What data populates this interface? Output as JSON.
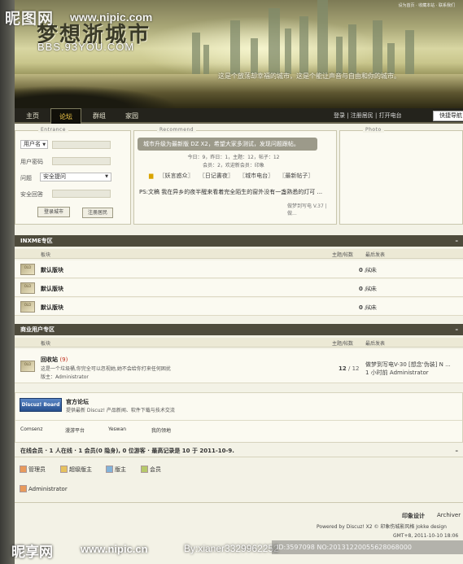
{
  "watermarks": {
    "top_left": "昵图网",
    "top_url": "www.nipic.com",
    "bottom_left": "昵享网",
    "bottom_url": "www.nipic.cn",
    "bottom_by": "By:xianer3329962252",
    "bottom_id": "ID:3597098 NO:20131220055628068000"
  },
  "banner": {
    "logo": "梦想浙城市",
    "logo_url": "BBS.93YOU.COM",
    "slogan": "这是个放荡却幸福的城市，这是个能让声音与自由和你的城市。",
    "tiny_links": "设为首页 · 收藏本站 · 联系我们"
  },
  "nav": {
    "items": [
      "主页",
      "论坛",
      "群组",
      "家园"
    ],
    "right_links": "登录 | 注册居民 | 打开电台",
    "quick_nav": "快捷导航"
  },
  "login": {
    "title": "Entrance",
    "username_select": "用户名",
    "password_label": "用户密码",
    "question_label": "问题",
    "question_select": "安全提问",
    "answer_label": "安全回答",
    "login_button": "登录城市",
    "register_button": "注册居民"
  },
  "recommend": {
    "title": "Recommend",
    "notice": "城市升级为最新版 DZ X2，希望大家多测试，发现问题跟帖。",
    "stats": "今日：9，昨日：1，主题：12，帖子：12",
    "members": "会员：2，欢迎新会员：印象",
    "tabs": [
      "〖妖言惑众〗",
      "〖日记書夜〗",
      "〖城市电台〗",
      "〖最新帖子〗"
    ],
    "ps_text": "PS:文稿  我在异乡的夜半醒来看着完全陌生的窗外没有一盏熟悉的灯可 ...",
    "ps_right": "做梦到写电 V.37 | 做..."
  },
  "photo": {
    "title": "Photo"
  },
  "section1": {
    "title": "INXME专区",
    "collapse": "–",
    "col_forum": "板块",
    "col_counts": "主题/帖数",
    "col_last": "最后发表",
    "rows": [
      {
        "icon": "OLD",
        "name": "默认版块",
        "topics": "0",
        "posts": "0",
        "last": "从未"
      },
      {
        "icon": "OLD",
        "name": "默认版块",
        "topics": "0",
        "posts": "0",
        "last": "从未"
      },
      {
        "icon": "OLD",
        "name": "默认版块",
        "topics": "0",
        "posts": "0",
        "last": "从未"
      }
    ]
  },
  "section2": {
    "title": "商业用户专区",
    "collapse": "–",
    "col_forum": "板块",
    "col_counts": "主题/帖数",
    "col_last": "最后发表",
    "row": {
      "icon": "OLD",
      "name": "回收站",
      "badge": "(9)",
      "desc": "这是一个垃圾桶,你完全可以忽视她,她不会给你打来任何困扰",
      "moderator": "版主：Administrator",
      "topics": "12",
      "posts": "12",
      "last_title": "做梦到写电V-30 [想念'伪装] N ...",
      "last_time": "1 小时前  Administrator"
    }
  },
  "official": {
    "logo": "Discuz! Board",
    "title": "官方论坛",
    "desc": "提供最新 Discuz! 产品新闻、软件下载与技术交流",
    "links": [
      "Comsenz",
      "漫游平台",
      "Yeswan",
      "我的领地"
    ]
  },
  "online": {
    "text": "在线会员 · 1 人在线 · 1 会员(0 隐身), 0 位游客 · 最高记录是 10 于 2011-10-9.",
    "collapse": "–",
    "legend": [
      "管理员",
      "超级版主",
      "版主",
      "会员"
    ],
    "user": "Administrator"
  },
  "footer": {
    "links": "印象设计",
    "archive": "Archiver",
    "powered": "Powered by Discuz! X2 © 印象伤城影风格 Jokke design",
    "time": "GMT+8, 2011-10-10 18:06"
  },
  "colors": {
    "nav_bg": "#24231c",
    "active_text": "#ffd34d",
    "section_head": "#4e4b3c",
    "count_red": "#c03020"
  }
}
